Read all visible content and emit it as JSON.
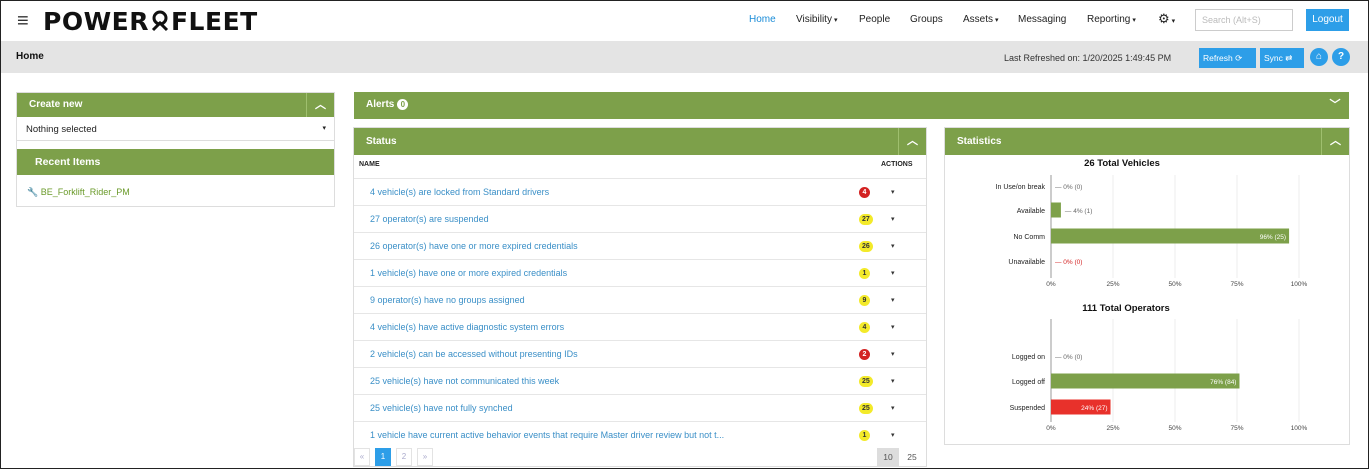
{
  "brand": {
    "logo_left": "POWER",
    "logo_right": "FLEET"
  },
  "nav": {
    "items": [
      {
        "label": "Home",
        "active": true,
        "caret": false
      },
      {
        "label": "Visibility",
        "active": false,
        "caret": true
      },
      {
        "label": "People",
        "active": false,
        "caret": false
      },
      {
        "label": "Groups",
        "active": false,
        "caret": false
      },
      {
        "label": "Assets",
        "active": false,
        "caret": true
      },
      {
        "label": "Messaging",
        "active": false,
        "caret": false
      },
      {
        "label": "Reporting",
        "active": false,
        "caret": true
      }
    ],
    "search_placeholder": "Search (Alt+S)",
    "logout_label": "Logout"
  },
  "breadcrumb": {
    "current": "Home"
  },
  "refresh_bar": {
    "last_refreshed": "Last Refreshed on: 1/20/2025 1:49:45 PM",
    "refresh_label": "Refresh",
    "sync_label": "Sync",
    "help_label": "?"
  },
  "create_new": {
    "title": "Create new",
    "selected": "Nothing selected"
  },
  "recent_items": {
    "title": "Recent Items",
    "items": [
      "BE_Forklift_Rider_PM"
    ]
  },
  "alerts": {
    "title": "Alerts",
    "count": "0"
  },
  "status": {
    "title": "Status",
    "col_name": "NAME",
    "col_actions": "ACTIONS",
    "rows": [
      {
        "text": "4 vehicle(s) are locked from Standard drivers",
        "count": "4",
        "color": "red"
      },
      {
        "text": "27 operator(s) are suspended",
        "count": "27",
        "color": "yellow"
      },
      {
        "text": "26 operator(s) have one or more expired credentials",
        "count": "26",
        "color": "yellow"
      },
      {
        "text": "1 vehicle(s) have one or more expired credentials",
        "count": "1",
        "color": "yellow"
      },
      {
        "text": "9 operator(s) have no groups assigned",
        "count": "9",
        "color": "yellow"
      },
      {
        "text": "4 vehicle(s) have active diagnostic system errors",
        "count": "4",
        "color": "yellow"
      },
      {
        "text": "2 vehicle(s) can be accessed without presenting IDs",
        "count": "2",
        "color": "red"
      },
      {
        "text": "25 vehicle(s) have not communicated this week",
        "count": "25",
        "color": "yellow"
      },
      {
        "text": "25 vehicle(s) have not fully synched",
        "count": "25",
        "color": "yellow"
      },
      {
        "text": "1 vehicle have current active behavior events that require Master driver review but not t...",
        "count": "1",
        "color": "yellow"
      }
    ],
    "pagination": {
      "prev": "«",
      "pages": [
        "1",
        "2"
      ],
      "next": "»",
      "current_page": "1",
      "page_sizes": [
        "10",
        "25"
      ],
      "current_size": "10"
    }
  },
  "statistics": {
    "title": "Statistics",
    "colors": {
      "bar": "#7da04a",
      "suspended": "#e8312b"
    },
    "chart_data": [
      {
        "type": "bar",
        "title": "26 Total Vehicles",
        "categories": [
          "In Use/on break",
          "Available",
          "No Comm",
          "Unavailable"
        ],
        "values": [
          0,
          4,
          96,
          0
        ],
        "labels": [
          "0% (0)",
          "4% (1)",
          "96% (25)",
          "0% (0)"
        ],
        "xticks": [
          "0%",
          "25%",
          "50%",
          "75%",
          "100%"
        ],
        "xlim": [
          0,
          100
        ]
      },
      {
        "type": "bar",
        "title": "111 Total Operators",
        "categories": [
          "Logged on",
          "Logged off",
          "Suspended"
        ],
        "values": [
          0,
          76,
          24
        ],
        "labels": [
          "0% (0)",
          "76% (84)",
          "24% (27)"
        ],
        "xticks": [
          "0%",
          "25%",
          "50%",
          "75%",
          "100%"
        ],
        "xlim": [
          0,
          100
        ]
      }
    ]
  }
}
